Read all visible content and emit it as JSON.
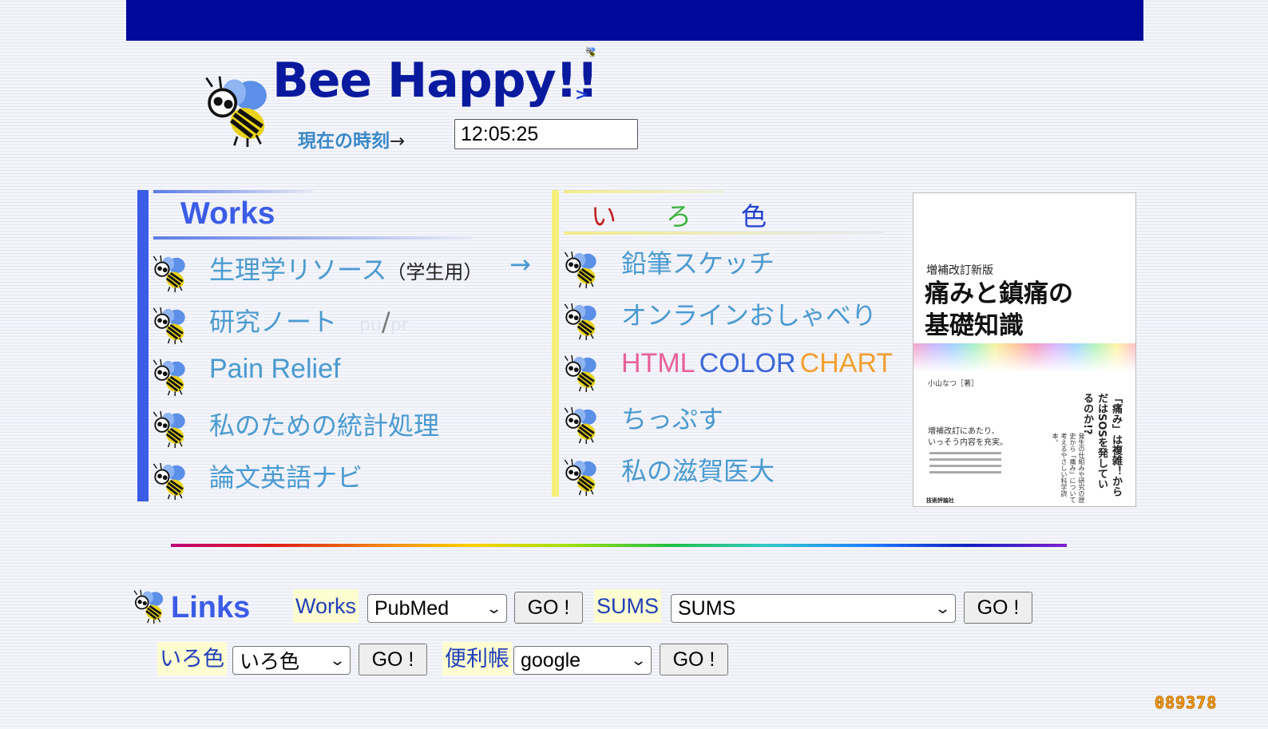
{
  "header": {
    "title": "Bee Happy!!",
    "title_arrow": ">",
    "time_label": "現在の時刻",
    "time_arrow": "→",
    "clock_value": "12:05:25"
  },
  "works": {
    "heading": "Works",
    "arrow": "→",
    "items": [
      {
        "label": "生理学リソース",
        "suffix": "（学生用）"
      },
      {
        "label": "研究ノート",
        "extra_left": "pu",
        "extra_slash": "/",
        "extra_right": "pr"
      },
      {
        "label": "Pain Relief"
      },
      {
        "label": "私のための統計処理"
      },
      {
        "label": "論文英語ナビ"
      }
    ]
  },
  "iro": {
    "heading_chars": [
      "い",
      "ろ",
      "色"
    ],
    "heading_colors": [
      "#c02020",
      "#3cb43c",
      "#2040d0"
    ],
    "items": [
      {
        "label": "鉛筆スケッチ"
      },
      {
        "label": "オンラインおしゃべり"
      },
      {
        "label_parts": [
          "HTML",
          "COLOR",
          "CHART"
        ],
        "label_colors": [
          "#e8609a",
          "#3a66d8",
          "#f2a030"
        ]
      },
      {
        "label": "ちっぷす"
      },
      {
        "label": "私の滋賀医大"
      }
    ]
  },
  "book": {
    "subtitle": "増補改訂新版",
    "title_line1": "痛みと鎮痛の",
    "title_line2": "基礎知識",
    "author": "小山なつ［著］",
    "tag_line1": "増補改訂にあたり、",
    "tag_line2": "いっそう内容を充実。",
    "vertical_main": "「痛み」は複雑！からだはSOSを発しているのか!?",
    "vertical_sub": "発生の仕組みや研究の歴史から「痛み」について考えるやさしい科学読本。",
    "publisher": "技術評論社"
  },
  "links": {
    "heading": "Links",
    "row1": [
      {
        "chip": "Works",
        "select": "PubMed",
        "button": "GO !"
      },
      {
        "chip": "SUMS",
        "select": "SUMS",
        "button": "GO !"
      }
    ],
    "row2": [
      {
        "chip": "いろ色",
        "select": "いろ色",
        "button": "GO !"
      },
      {
        "chip": "便利帳",
        "select": "google",
        "button": "GO !"
      }
    ]
  },
  "counter": "089378",
  "colors": {
    "topbar": "#000999",
    "works_accent": "#3b5ce6",
    "iro_accent": "#f7f07a",
    "link_text": "#4a9ad0"
  }
}
